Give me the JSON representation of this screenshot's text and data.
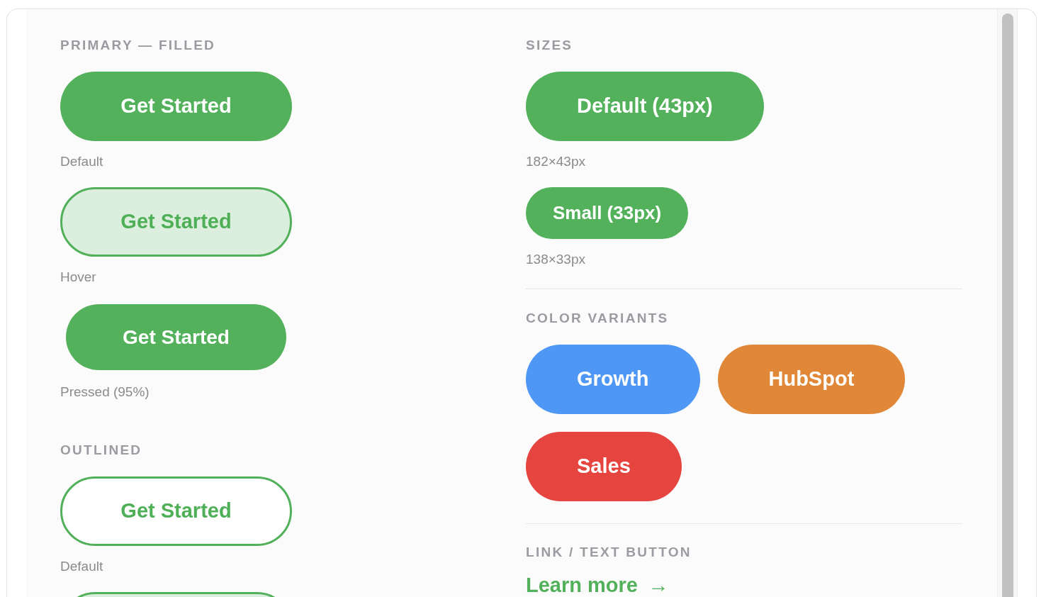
{
  "left_column": [
    {
      "heading": "PRIMARY — FILLED",
      "items": [
        {
          "kind": "filled",
          "label": "Get Started",
          "caption": "Default"
        },
        {
          "kind": "hover",
          "label": "Get Started",
          "caption": "Hover"
        },
        {
          "kind": "pressed",
          "label": "Get Started",
          "caption": "Pressed (95%)"
        }
      ]
    },
    {
      "heading": "OUTLINED",
      "items": [
        {
          "kind": "outlined",
          "label": "Get Started",
          "caption": "Default"
        },
        {
          "kind": "outlined-hover"
        }
      ]
    }
  ],
  "right_column": [
    {
      "heading": "SIZES",
      "items": [
        {
          "kind": "filled-default",
          "label": "Default (43px)",
          "caption": "182×43px"
        },
        {
          "kind": "filled-small",
          "label": "Small (33px)",
          "caption": "138×33px"
        }
      ]
    },
    {
      "heading": "COLOR VARIANTS",
      "items": [
        {
          "kind": "color",
          "label": "Growth",
          "color": "#4f97f5"
        },
        {
          "kind": "color",
          "label": "HubSpot",
          "color": "#e08838"
        },
        {
          "kind": "color",
          "label": "Sales",
          "color": "#e5453e"
        }
      ]
    },
    {
      "heading": "LINK / TEXT BUTTON",
      "items": [
        {
          "kind": "link",
          "label": "Learn more",
          "icon": "→"
        }
      ]
    }
  ]
}
